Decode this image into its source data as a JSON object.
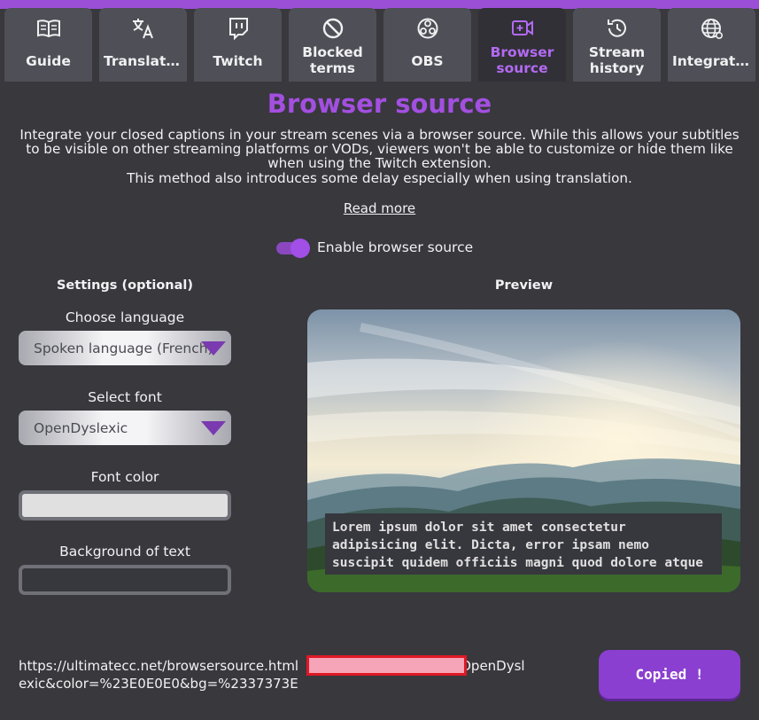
{
  "tabs": [
    {
      "label": "Guide",
      "icon": "book-icon"
    },
    {
      "label": "Translati…",
      "icon": "translate-icon"
    },
    {
      "label": "Twitch",
      "icon": "twitch-icon"
    },
    {
      "label": "Blocked terms",
      "icon": "block-icon"
    },
    {
      "label": "OBS",
      "icon": "obs-icon"
    },
    {
      "label": "Browser source",
      "icon": "video-add-icon"
    },
    {
      "label": "Stream history",
      "icon": "history-icon"
    },
    {
      "label": "Integrati…",
      "icon": "globe-icon"
    }
  ],
  "active_tab": "Browser source",
  "page": {
    "title": "Browser source",
    "intro": "Integrate your closed captions in your stream scenes via a browser source. While this allows your subtitles to be visible on other streaming platforms or VODs, viewers won't be able to customize or hide them like when using the Twitch extension.",
    "intro2": "This method also introduces some delay especially when using translation.",
    "read_more": "Read more",
    "toggle_label": "Enable browser source",
    "toggle_on": true
  },
  "settings": {
    "heading": "Settings (optional)",
    "language_label": "Choose language",
    "language_value": "Spoken language (French)",
    "font_label": "Select font",
    "font_value": "OpenDyslexic",
    "font_color_label": "Font color",
    "font_color": "#E0E0E0",
    "bg_label": "Background of text",
    "bg_color": "#37373E"
  },
  "preview": {
    "heading": "Preview",
    "caption": "Lorem ipsum dolor sit amet consectetur adipisicing elit. Dicta, error ipsam nemo suscipit quidem officiis magni quod dolore atque"
  },
  "url": {
    "prefix": "https://ultimatecc.net/browsersource.html",
    "suffix": "OpenDyslexic&color=%23E0E0E0&bg=%2337373E"
  },
  "copy_button": "Copied !",
  "colors": {
    "accent": "#A34FE0",
    "background": "#38383D",
    "tab": "#4F4F57",
    "tab_active": "#303036"
  }
}
